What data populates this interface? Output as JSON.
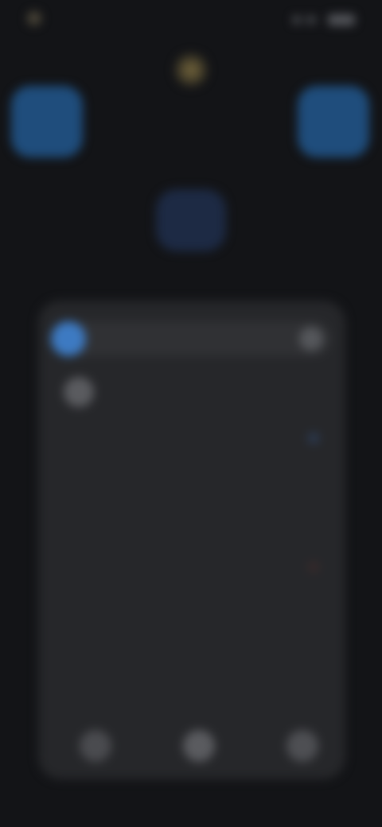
{
  "status_bar": {
    "time": "",
    "carrier": ""
  },
  "quick": {
    "left_label": "",
    "right_label": "",
    "center_label": ""
  },
  "panel": {
    "tabs": [
      {
        "label": ""
      },
      {
        "label": ""
      },
      {
        "label": ""
      },
      {
        "label": ""
      }
    ],
    "account_label": "",
    "items": [
      {
        "label": ""
      },
      {
        "label": ""
      },
      {
        "label": ""
      },
      {
        "label": ""
      },
      {
        "label": ""
      },
      {
        "label": ""
      }
    ],
    "footer_label": ""
  },
  "colors": {
    "accent": "#3d7ac2",
    "background": "#131417",
    "panel": "#26272a",
    "quick_button": "#1f4d7c"
  }
}
